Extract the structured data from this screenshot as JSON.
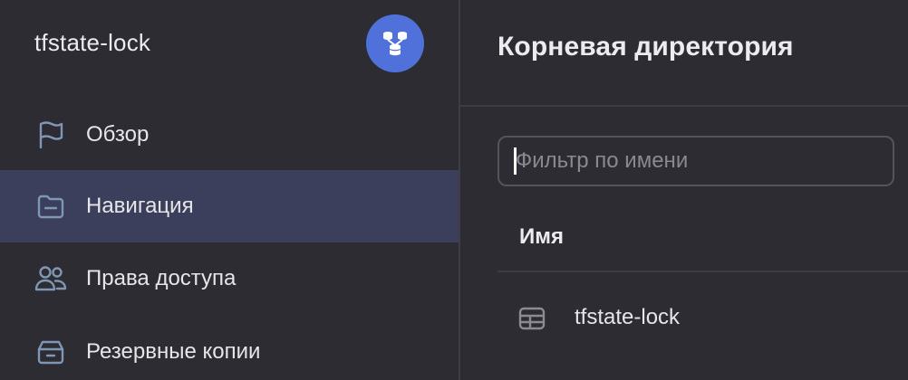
{
  "sidebar": {
    "database_title": "tfstate-lock",
    "badge_icon": "database-cluster-icon",
    "accent_color": "#4f71d9",
    "items": [
      {
        "label": "Обзор",
        "icon": "flag-icon",
        "active": false
      },
      {
        "label": "Навигация",
        "icon": "folder-icon",
        "active": true
      },
      {
        "label": "Права доступа",
        "icon": "users-icon",
        "active": false
      },
      {
        "label": "Резервные копии",
        "icon": "archive-icon",
        "active": false
      }
    ]
  },
  "main": {
    "title": "Корневая директория",
    "filter": {
      "placeholder": "Фильтр по имени",
      "value": ""
    },
    "table": {
      "columns": [
        "Имя"
      ],
      "rows": [
        {
          "name": "tfstate-lock",
          "icon": "table-icon"
        }
      ]
    }
  }
}
